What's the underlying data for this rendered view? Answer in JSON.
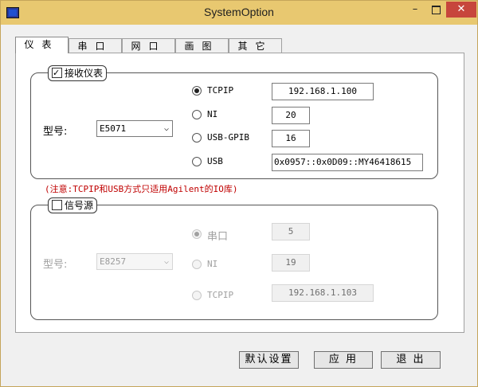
{
  "window": {
    "title": "SystemOption",
    "min": "–",
    "max": "",
    "close": "✕"
  },
  "tabs": [
    {
      "label": "仪表",
      "active": true
    },
    {
      "label": "串口",
      "active": false
    },
    {
      "label": "网口",
      "active": false
    },
    {
      "label": "画图",
      "active": false
    },
    {
      "label": "其它",
      "active": false
    }
  ],
  "receiver": {
    "checkbox_label": "接收仪表",
    "checked": true,
    "model_label": "型号:",
    "model_value": "E5071",
    "options": [
      {
        "label": "TCPIP",
        "selected": true,
        "value": "192.168.1.100"
      },
      {
        "label": "NI",
        "selected": false,
        "value": "20"
      },
      {
        "label": "USB-GPIB",
        "selected": false,
        "value": "16"
      },
      {
        "label": "USB",
        "selected": false,
        "value": "0x0957::0x0D09::MY46418615"
      }
    ]
  },
  "note": "(注意:TCPIP和USB方式只适用Agilent的IO库)",
  "source": {
    "checkbox_label": "信号源",
    "checked": false,
    "model_label": "型号:",
    "model_value": "E8257",
    "options": [
      {
        "label": "串口",
        "selected": true,
        "value": "5"
      },
      {
        "label": "NI",
        "selected": false,
        "value": "19"
      },
      {
        "label": "TCPIP",
        "selected": false,
        "value": "192.168.1.103"
      }
    ]
  },
  "buttons": {
    "default": "默认设置",
    "apply": "应 用",
    "exit": "退 出"
  },
  "colors": {
    "titlebar": "#e8c870",
    "close": "#c7463c",
    "note": "#c00000"
  }
}
